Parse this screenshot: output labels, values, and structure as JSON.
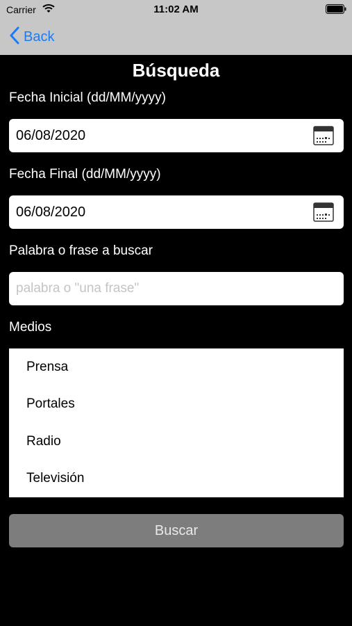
{
  "status_bar": {
    "carrier": "Carrier",
    "time": "11:02 AM",
    "wifi_icon": "wifi-icon",
    "battery_icon": "battery-icon"
  },
  "nav": {
    "back_label": "Back",
    "back_icon": "chevron-left-icon",
    "accent_color": "#1a7cf5"
  },
  "page": {
    "title": "Búsqueda"
  },
  "form": {
    "start_date": {
      "label": "Fecha Inicial (dd/MM/yyyy)",
      "value": "06/08/2020",
      "icon": "calendar-icon"
    },
    "end_date": {
      "label": "Fecha Final (dd/MM/yyyy)",
      "value": "06/08/2020",
      "icon": "calendar-icon"
    },
    "search": {
      "label": "Palabra o frase a buscar",
      "placeholder": "palabra o \"una frase\""
    },
    "media": {
      "label": "Medios",
      "items": [
        "Prensa",
        "Portales",
        "Radio",
        "Televisión"
      ]
    },
    "submit_label": "Buscar"
  }
}
